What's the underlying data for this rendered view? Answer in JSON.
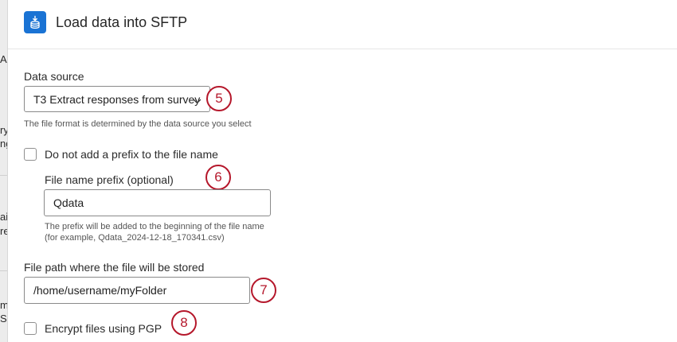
{
  "window": {
    "title": "Load data into SFTP"
  },
  "left_strip": {
    "fragments": [
      "A",
      "ry",
      "ng",
      "ai",
      "re",
      "m",
      "S"
    ]
  },
  "data_source": {
    "label": "Data source",
    "selected": "T3 Extract responses from survey",
    "help": "The file format is determined by the data source you select"
  },
  "no_prefix": {
    "label": "Do not add a prefix to the file name",
    "checked": false
  },
  "prefix": {
    "label": "File name prefix (optional)",
    "value": "Qdata",
    "help_line1": "The prefix will be added to the beginning of the file name",
    "help_line2": "(for example, Qdata_2024-12-18_170341.csv)"
  },
  "file_path": {
    "label": "File path where the file will be stored",
    "value": "/home/username/myFolder"
  },
  "encrypt": {
    "label": "Encrypt files using PGP",
    "checked": false
  },
  "markers": [
    "5",
    "6",
    "7",
    "8"
  ],
  "colors": {
    "accent": "#1a73d4",
    "marker": "#b5172b"
  },
  "icons": {
    "app": "database-download-icon",
    "caret": "chevron-down-icon"
  }
}
